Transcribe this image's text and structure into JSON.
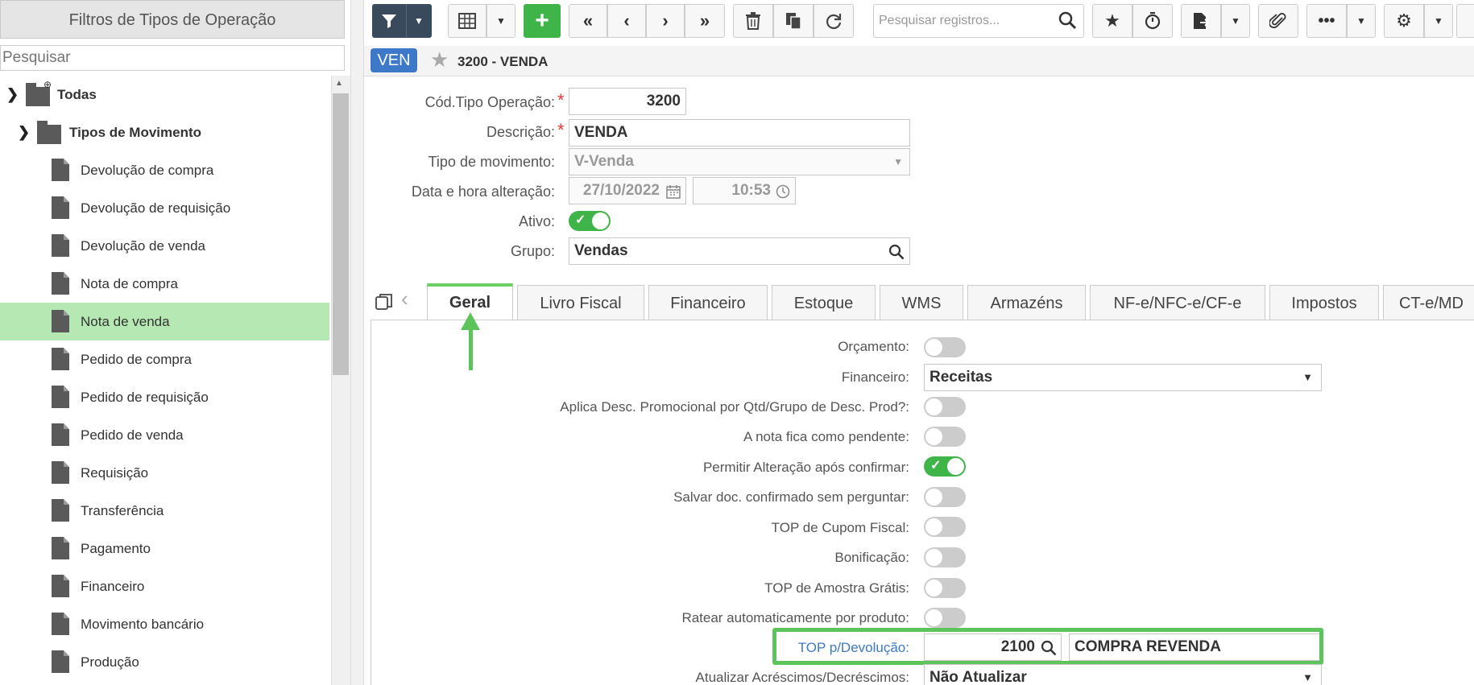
{
  "left_panel": {
    "title": "Filtros de Tipos de Operação",
    "search_placeholder": "Pesquisar",
    "root": "Todas",
    "group": "Tipos de Movimento",
    "items": [
      {
        "label": "Devolução de compra"
      },
      {
        "label": "Devolução de requisição"
      },
      {
        "label": "Devolução de venda"
      },
      {
        "label": "Nota de compra"
      },
      {
        "label": "Nota de venda",
        "selected": true
      },
      {
        "label": "Pedido de compra"
      },
      {
        "label": "Pedido de requisição"
      },
      {
        "label": "Pedido de venda"
      },
      {
        "label": "Requisição"
      },
      {
        "label": "Transferência"
      },
      {
        "label": "Pagamento"
      },
      {
        "label": "Financeiro"
      },
      {
        "label": "Movimento bancário"
      },
      {
        "label": "Produção"
      }
    ]
  },
  "toolbar": {
    "search_placeholder": "Pesquisar registros..."
  },
  "header": {
    "badge": "VEN",
    "title": "3200 - VENDA"
  },
  "form": {
    "cod_label": "Cód.Tipo Operação:",
    "cod_value": "3200",
    "desc_label": "Descrição:",
    "desc_value": "VENDA",
    "tipo_label": "Tipo de movimento:",
    "tipo_value": "V-Venda",
    "data_label": "Data e hora alteração:",
    "data_value": "27/10/2022",
    "hora_value": "10:53",
    "ativo_label": "Ativo:",
    "grupo_label": "Grupo:",
    "grupo_value": "Vendas"
  },
  "tabs": [
    "Geral",
    "Livro Fiscal",
    "Financeiro",
    "Estoque",
    "WMS",
    "Armazéns",
    "NF-e/NFC-e/CF-e",
    "Impostos",
    "CT-e/MD"
  ],
  "geral": {
    "orcamento": "Orçamento:",
    "financeiro_label": "Financeiro:",
    "financeiro_value": "Receitas",
    "aplica": "Aplica Desc. Promocional por Qtd/Grupo de Desc. Prod?:",
    "pendente": "A nota fica como pendente:",
    "permitir": "Permitir Alteração após confirmar:",
    "salvar": "Salvar doc. confirmado sem perguntar:",
    "cupom": "TOP de Cupom Fiscal:",
    "bonificacao": "Bonificação:",
    "amostra": "TOP de Amostra Grátis:",
    "ratear": "Ratear automaticamente por produto:",
    "top_dev_label": "TOP p/Devolução:",
    "top_dev_code": "2100",
    "top_dev_desc": "COMPRA REVENDA",
    "atualizar_label": "Atualizar Acréscimos/Decréscimos:",
    "atualizar_value": "Não Atualizar"
  },
  "colors": {
    "accent_green": "#3fb449",
    "highlight": "#5cc45a",
    "badge_blue": "#3d78c9",
    "selected_row": "#b6e8b3"
  }
}
